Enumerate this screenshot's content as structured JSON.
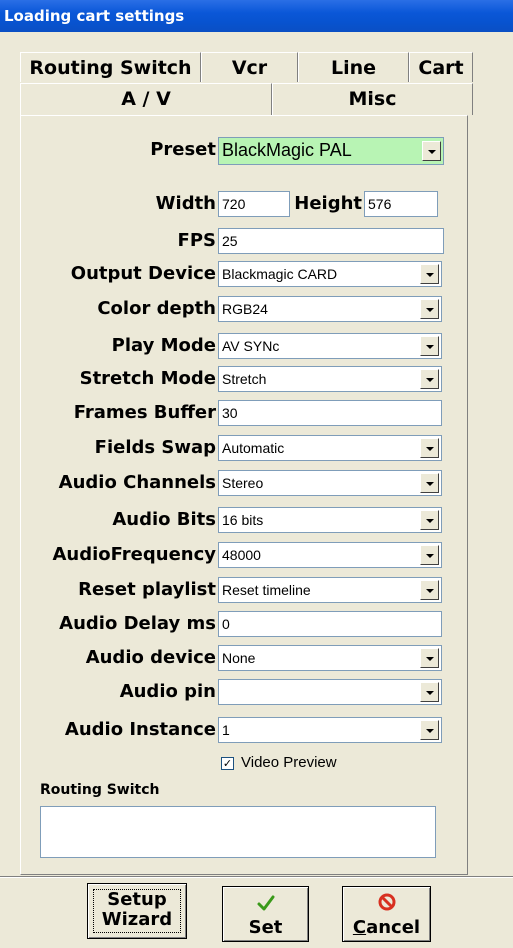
{
  "window": {
    "title": "Loading cart settings"
  },
  "tabs": {
    "row1": [
      "Routing Switch",
      "Vcr",
      "Line",
      "Cart"
    ],
    "row2": [
      "A / V",
      "Misc"
    ],
    "active": "A / V"
  },
  "form": {
    "preset": {
      "label": "Preset",
      "value": "BlackMagic PAL"
    },
    "width": {
      "label": "Width",
      "value": "720"
    },
    "height": {
      "label": "Height",
      "value": "576"
    },
    "fps": {
      "label": "FPS",
      "value": "25"
    },
    "output_device": {
      "label": "Output Device",
      "value": "Blackmagic CARD"
    },
    "color_depth": {
      "label": "Color depth",
      "value": "RGB24"
    },
    "play_mode": {
      "label": "Play Mode",
      "value": "AV SYNc"
    },
    "stretch_mode": {
      "label": "Stretch Mode",
      "value": "Stretch"
    },
    "frames_buffer": {
      "label": "Frames Buffer",
      "value": "30"
    },
    "fields_swap": {
      "label": "Fields Swap",
      "value": "Automatic"
    },
    "audio_channels": {
      "label": "Audio Channels",
      "value": "Stereo"
    },
    "audio_bits": {
      "label": "Audio Bits",
      "value": "16 bits"
    },
    "audio_frequency": {
      "label": "AudioFrequency",
      "value": "48000"
    },
    "reset_playlist": {
      "label": "Reset playlist",
      "value": "Reset timeline"
    },
    "audio_delay": {
      "label": "Audio Delay ms",
      "value": "0"
    },
    "audio_device": {
      "label": "Audio device",
      "value": "None"
    },
    "audio_pin": {
      "label": "Audio pin",
      "value": ""
    },
    "audio_instance": {
      "label": "Audio Instance",
      "value": "1"
    },
    "video_preview": {
      "label": "Video Preview",
      "checked": true,
      "mark": "✓"
    },
    "routing_switch": {
      "label": "Routing Switch",
      "value": ""
    }
  },
  "buttons": {
    "setup_wizard": {
      "line1": "Setup",
      "line2": "Wizard"
    },
    "set": {
      "label": "Set",
      "icon": "check-icon",
      "icon_color": "#3a9a1a"
    },
    "cancel": {
      "label": "Cancel",
      "icon": "stop-icon",
      "icon_color": "#d83020"
    }
  },
  "colors": {
    "title_bar": "#0a57d8",
    "preset_bg": "#b8f4b4",
    "window_bg": "#ece9d8"
  }
}
